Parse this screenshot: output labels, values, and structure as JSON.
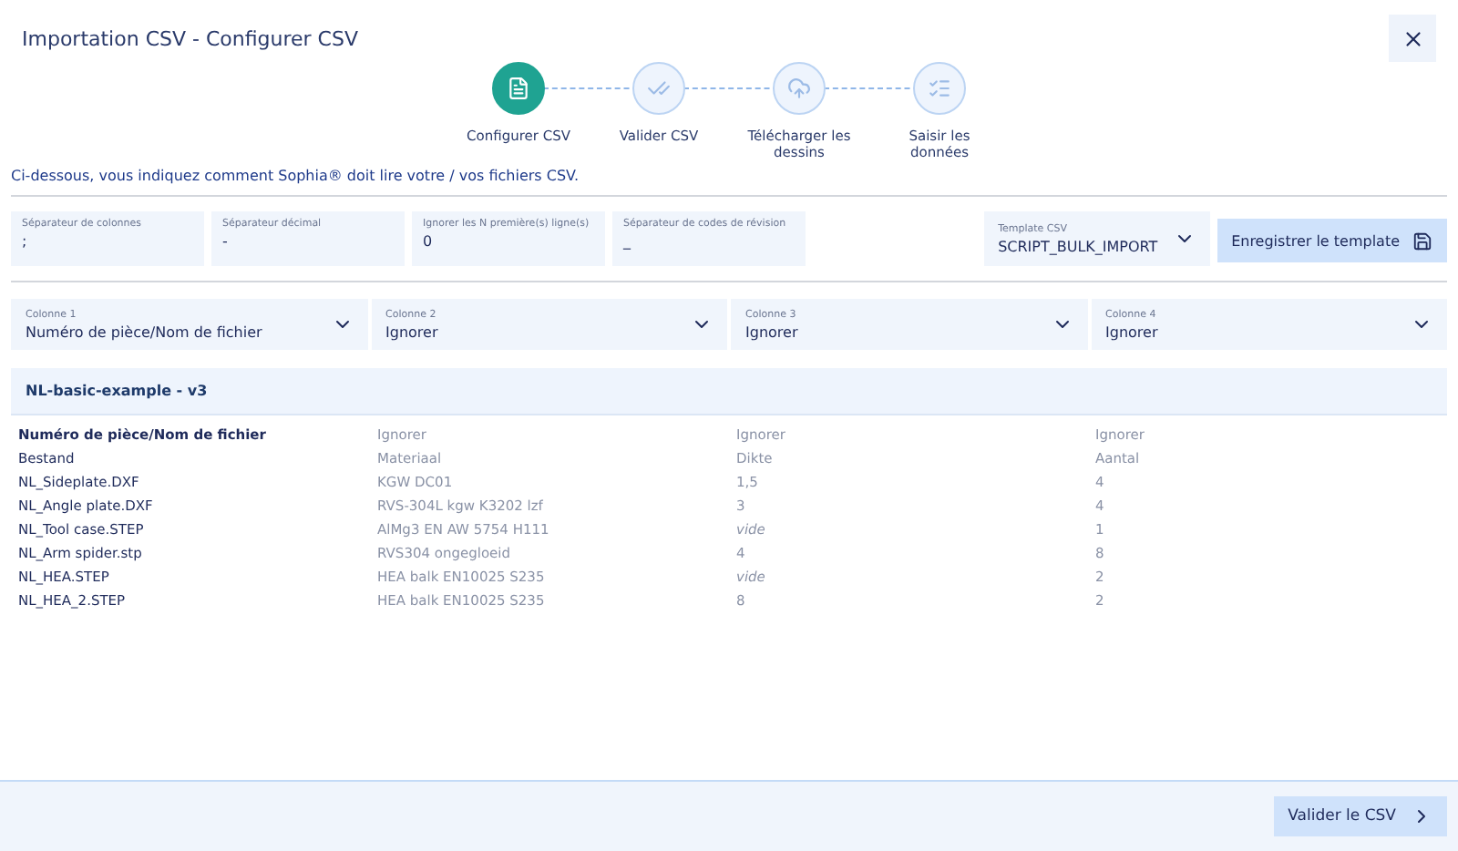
{
  "window": {
    "title": "Importation CSV - Configurer CSV"
  },
  "steps": [
    {
      "label": "Configurer CSV",
      "kind": "csv",
      "selected": true
    },
    {
      "label": "Valider CSV",
      "kind": "check",
      "selected": false
    },
    {
      "label": "Télécharger les dessins",
      "kind": "upload",
      "selected": false
    },
    {
      "label": "Saisir les données",
      "kind": "list",
      "selected": false
    }
  ],
  "intro": "Ci-dessous, vous indiquez comment Sophia® doit lire votre / vos fichiers CSV.",
  "settings": [
    {
      "label": "Séparateur de colonnes",
      "value": ";"
    },
    {
      "label": "Séparateur décimal",
      "value": "-"
    },
    {
      "label": "Ignorer les N première(s) ligne(s)",
      "value": "0"
    },
    {
      "label": "Séparateur de codes de révision",
      "value": "_"
    }
  ],
  "template": {
    "label": "Template CSV",
    "value": "SCRIPT_BULK_IMPORT"
  },
  "save_button": "Enregistrer le template",
  "column_selects": [
    {
      "label": "Colonne 1",
      "value": "Numéro de pièce/Nom de fichier"
    },
    {
      "label": "Colonne 2",
      "value": "Ignorer"
    },
    {
      "label": "Colonne 3",
      "value": "Ignorer"
    },
    {
      "label": "Colonne 4",
      "value": "Ignorer"
    }
  ],
  "preview": {
    "title": "NL-basic-example - v3",
    "header": [
      "Numéro de pièce/Nom de fichier",
      "Ignorer",
      "Ignorer",
      "Ignorer"
    ],
    "rows": [
      [
        {
          "text": "Bestand",
          "kind": "value"
        },
        {
          "text": "Materiaal",
          "kind": "value"
        },
        {
          "text": "Dikte",
          "kind": "value"
        },
        {
          "text": "Aantal",
          "kind": "value"
        }
      ],
      [
        {
          "text": "NL_Sideplate.DXF",
          "kind": "value"
        },
        {
          "text": "KGW DC01",
          "kind": "value"
        },
        {
          "text": "1,5",
          "kind": "value"
        },
        {
          "text": "4",
          "kind": "value"
        }
      ],
      [
        {
          "text": "NL_Angle plate.DXF",
          "kind": "value"
        },
        {
          "text": "RVS-304L kgw K3202 lzf",
          "kind": "value"
        },
        {
          "text": "3",
          "kind": "value"
        },
        {
          "text": "4",
          "kind": "value"
        }
      ],
      [
        {
          "text": "NL_Tool case.STEP",
          "kind": "value"
        },
        {
          "text": "AlMg3 EN AW 5754 H111",
          "kind": "value"
        },
        {
          "text": "vide",
          "kind": "empty"
        },
        {
          "text": "1",
          "kind": "value"
        }
      ],
      [
        {
          "text": "NL_Arm spider.stp",
          "kind": "value"
        },
        {
          "text": "RVS304 ongegloeid",
          "kind": "value"
        },
        {
          "text": "4",
          "kind": "value"
        },
        {
          "text": "8",
          "kind": "value"
        }
      ],
      [
        {
          "text": "NL_HEA.STEP",
          "kind": "value"
        },
        {
          "text": "HEA balk EN10025 S235",
          "kind": "value"
        },
        {
          "text": "vide",
          "kind": "empty"
        },
        {
          "text": "2",
          "kind": "value"
        }
      ],
      [
        {
          "text": "NL_HEA_2.STEP",
          "kind": "value"
        },
        {
          "text": "HEA balk EN10025 S235",
          "kind": "value"
        },
        {
          "text": "8",
          "kind": "value"
        },
        {
          "text": "2",
          "kind": "value"
        }
      ]
    ]
  },
  "next_button": "Valider le CSV"
}
